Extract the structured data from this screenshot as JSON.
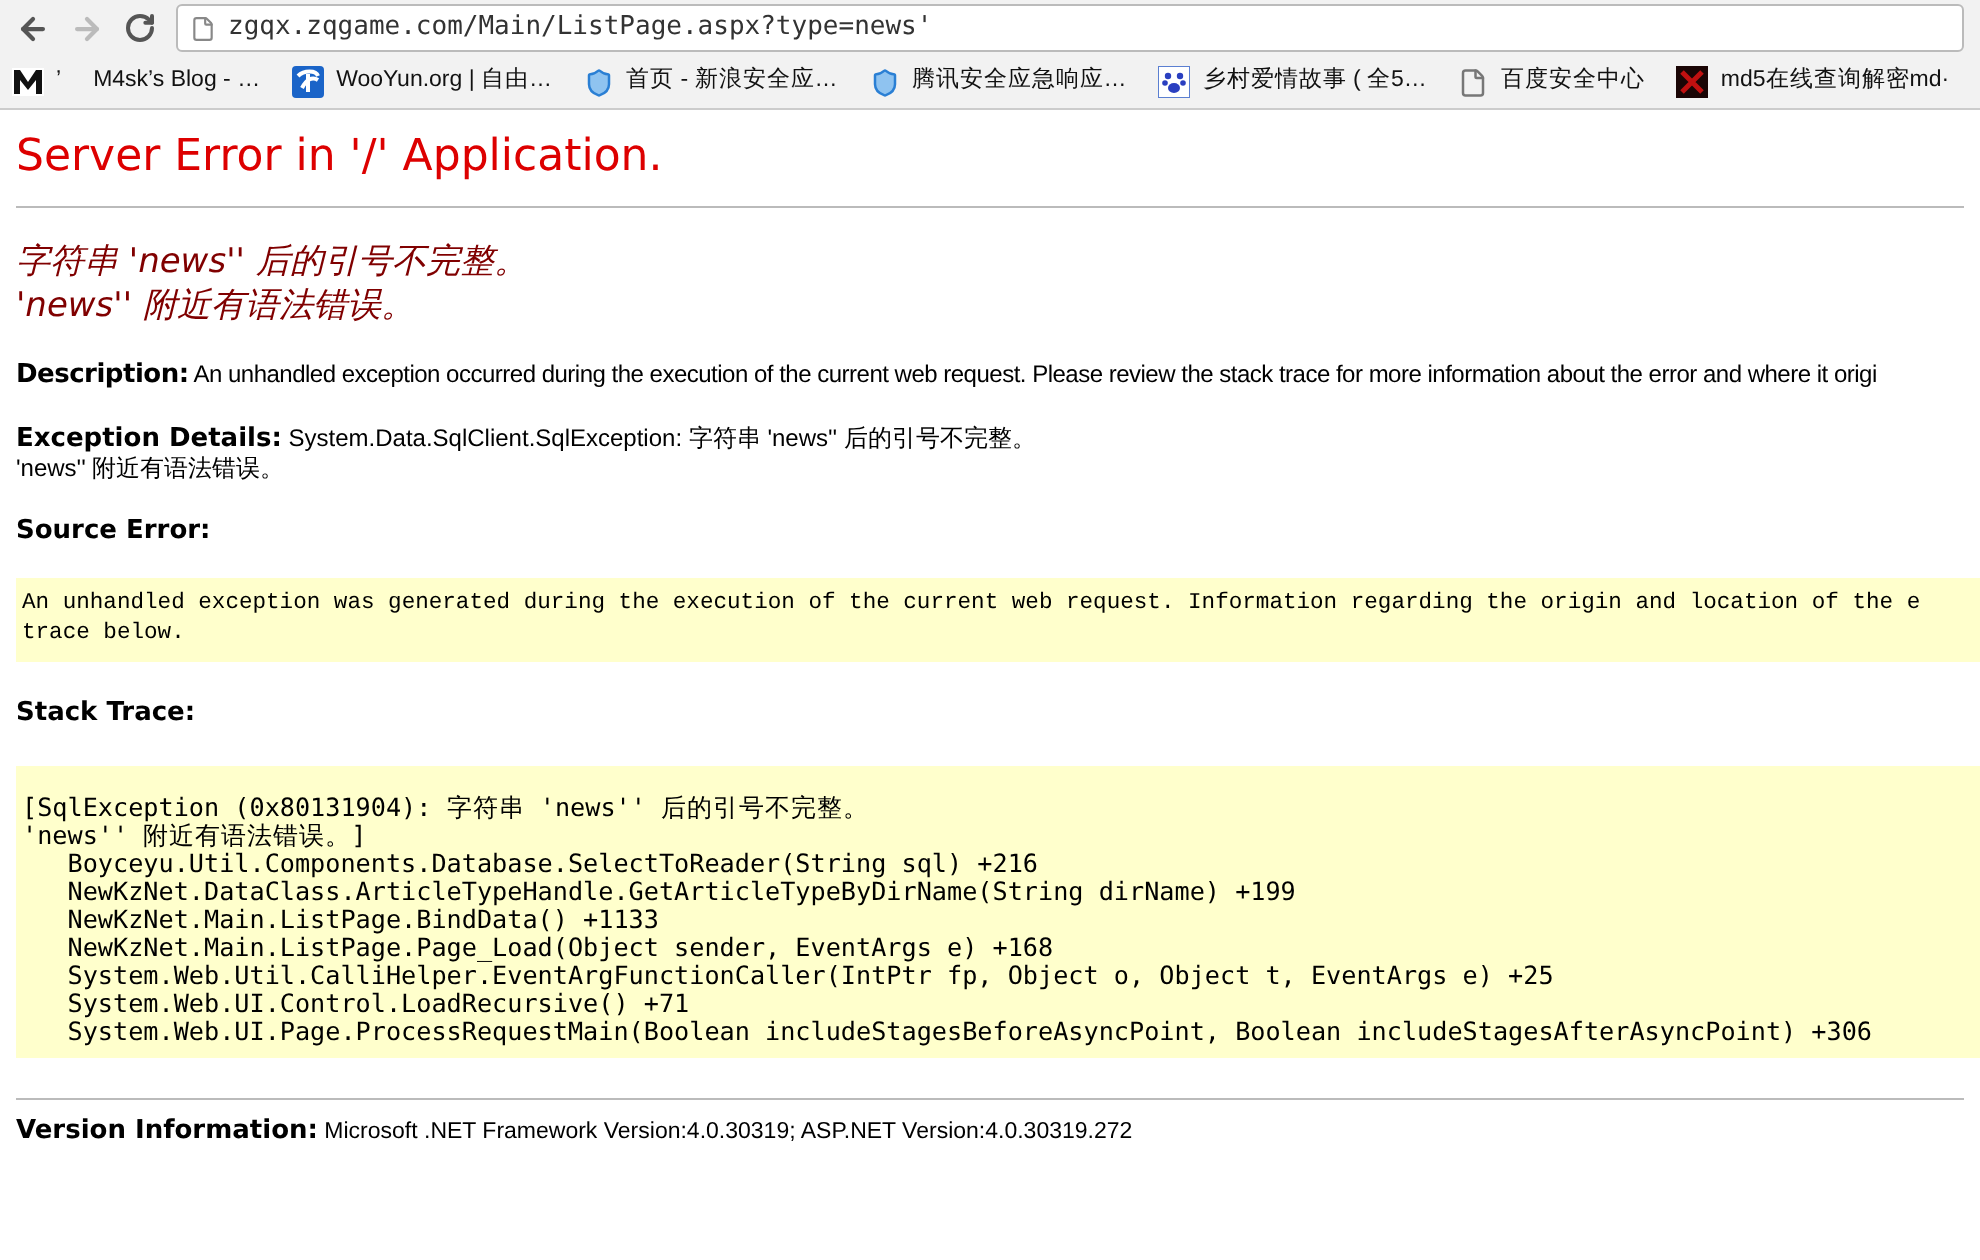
{
  "browser": {
    "url": "zgqx.zqgame.com/Main/ListPage.aspx?type=news'"
  },
  "bookmarks": [
    {
      "kind": "m",
      "label": "’"
    },
    {
      "kind": "none",
      "label": "M4sk’s Blog - …"
    },
    {
      "kind": "wooyun",
      "label": "WooYun.org | 自由…"
    },
    {
      "kind": "shield",
      "label": "首页 - 新浪安全应…"
    },
    {
      "kind": "shield",
      "label": "腾讯安全应急响应…"
    },
    {
      "kind": "paw",
      "label": "乡村爱情故事 ( 全5…"
    },
    {
      "kind": "page",
      "label": "百度安全中心"
    },
    {
      "kind": "dark",
      "label": "md5在线查询解密md·"
    }
  ],
  "page": {
    "title": "Server Error in '/' Application.",
    "error_lines": [
      "字符串 'news'' 后的引号不完整。",
      "'news'' 附近有语法错误。"
    ],
    "description": {
      "label": "Description:",
      "text": "An unhandled exception occurred during the execution of the current web request. Please review the stack trace for more information about the error and where it origi"
    },
    "exception_details": {
      "label": "Exception Details:",
      "text": "System.Data.SqlClient.SqlException: 字符串 'news'' 后的引号不完整。",
      "text_2": "'news'' 附近有语法错误。"
    },
    "source_error": {
      "label": "Source Error:",
      "lines": [
        "An unhandled exception was generated during the execution of the current web request. Information regarding the origin and location of the e",
        "trace below."
      ]
    },
    "stack_trace": {
      "label": "Stack Trace:",
      "lines": [
        "[SqlException (0x80131904): 字符串 'news'' 后的引号不完整。",
        "'news'' 附近有语法错误。]",
        "   Boyceyu.Util.Components.Database.SelectToReader(String sql) +216",
        "   NewKzNet.DataClass.ArticleTypeHandle.GetArticleTypeByDirName(String dirName) +199",
        "   NewKzNet.Main.ListPage.BindData() +1133",
        "   NewKzNet.Main.ListPage.Page_Load(Object sender, EventArgs e) +168",
        "   System.Web.Util.CalliHelper.EventArgFunctionCaller(IntPtr fp, Object o, Object t, EventArgs e) +25",
        "   System.Web.UI.Control.LoadRecursive() +71",
        "   System.Web.UI.Page.ProcessRequestMain(Boolean includeStagesBeforeAsyncPoint, Boolean includeStagesAfterAsyncPoint) +306"
      ]
    },
    "version_info": {
      "label": "Version Information:",
      "text": "Microsoft .NET Framework Version:4.0.30319; ASP.NET Version:4.0.30319.272"
    }
  }
}
